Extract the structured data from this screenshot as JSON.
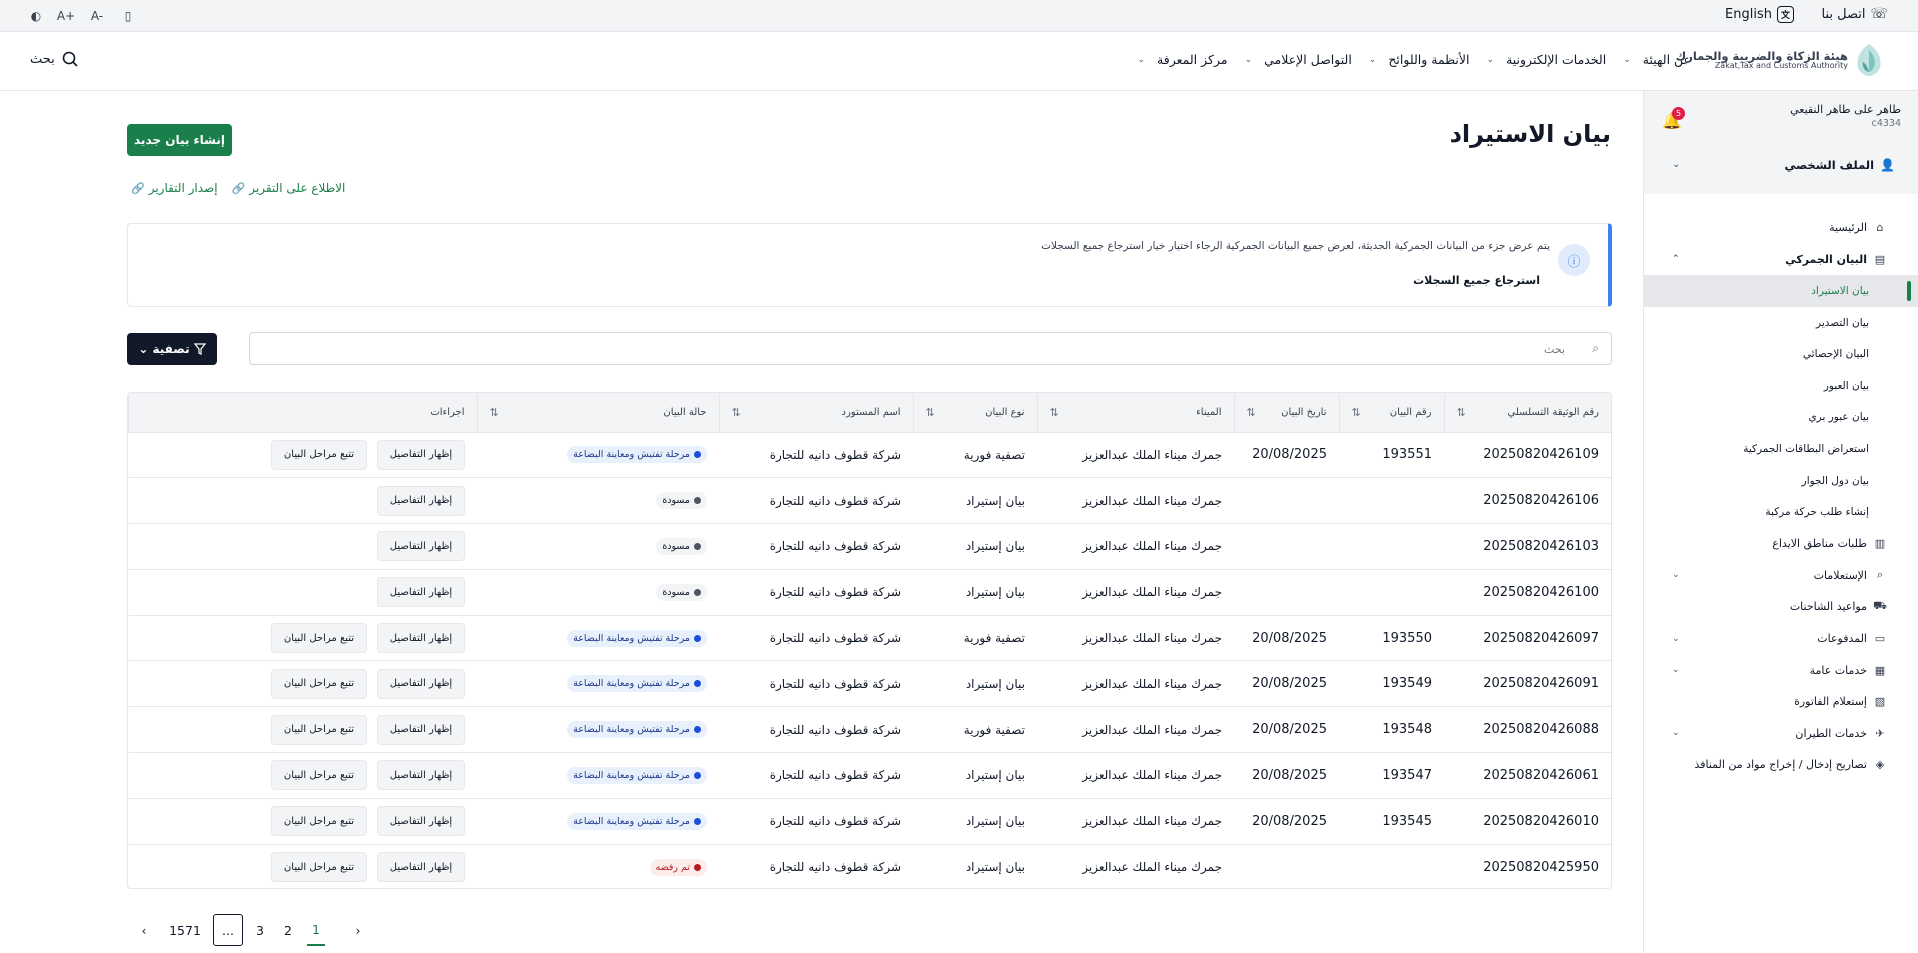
{
  "utility": {
    "contact_label": "اتصل بنا",
    "language_label": "English"
  },
  "nav": {
    "search_label": "بحث",
    "items": [
      {
        "label": "عن الهيئة"
      },
      {
        "label": "الخدمات الإلكترونية"
      },
      {
        "label": "الأنظمة واللوائح"
      },
      {
        "label": "التواصل الإعلامي"
      },
      {
        "label": "مركز المعرفة"
      }
    ],
    "logo_ar": "هيئة الزكاة والضريبة والجمارك",
    "logo_en": "Zakat,Tax and Customs Authority"
  },
  "page": {
    "title": "بيان الاستيراد",
    "create_button": "إنشاء بيان جديد",
    "link_report_view": "الاطلاع على التقرير",
    "link_reports_issue": "إصدار التقارير"
  },
  "info": {
    "message": "يتم عرض جزء من البيانات الجمركية الحديثة، لعرض جميع البيانات الجمركية الرجاء اختيار خيار استرجاع جميع السجلات",
    "action": "استرجاع جميع السجلات"
  },
  "filter": {
    "search_placeholder": "بحث",
    "filter_button": "تصفية"
  },
  "table": {
    "headers": [
      "رقم الوثيقة التسلسلي",
      "رقم البيان",
      "تاريخ البيان",
      "الميناء",
      "نوع البيان",
      "اسم المستورد",
      "حالة البيان",
      "اجراءات"
    ],
    "details_label": "إظهار التفاصيل",
    "track_label": "تتبع مراحل البيان",
    "rows": [
      {
        "serial": "20250820426109",
        "decl_no": "193551",
        "date": "20/08/2025",
        "port": "جمرك ميناء الملك عبدالعزيز",
        "type": "تصفية فورية",
        "importer": "شركة قطوف دانيه للتجارة",
        "status": "مرحلة تفتيش ومعاينة البضاعة",
        "status_kind": "inspect",
        "track": true
      },
      {
        "serial": "20250820426106",
        "decl_no": "",
        "date": "",
        "port": "جمرك ميناء الملك عبدالعزيز",
        "type": "بيان إستيراد",
        "importer": "شركة قطوف دانيه للتجارة",
        "status": "مسودة",
        "status_kind": "draft",
        "track": false
      },
      {
        "serial": "20250820426103",
        "decl_no": "",
        "date": "",
        "port": "جمرك ميناء الملك عبدالعزيز",
        "type": "بيان إستيراد",
        "importer": "شركة قطوف دانيه للتجارة",
        "status": "مسودة",
        "status_kind": "draft",
        "track": false
      },
      {
        "serial": "20250820426100",
        "decl_no": "",
        "date": "",
        "port": "جمرك ميناء الملك عبدالعزيز",
        "type": "بيان إستيراد",
        "importer": "شركة قطوف دانيه للتجارة",
        "status": "مسودة",
        "status_kind": "draft",
        "track": false
      },
      {
        "serial": "20250820426097",
        "decl_no": "193550",
        "date": "20/08/2025",
        "port": "جمرك ميناء الملك عبدالعزيز",
        "type": "تصفية فورية",
        "importer": "شركة قطوف دانيه للتجارة",
        "status": "مرحلة تفتيش ومعاينة البضاعة",
        "status_kind": "inspect",
        "track": true
      },
      {
        "serial": "20250820426091",
        "decl_no": "193549",
        "date": "20/08/2025",
        "port": "جمرك ميناء الملك عبدالعزيز",
        "type": "بيان إستيراد",
        "importer": "شركة قطوف دانيه للتجارة",
        "status": "مرحلة تفتيش ومعاينة البضاعة",
        "status_kind": "inspect",
        "track": true
      },
      {
        "serial": "20250820426088",
        "decl_no": "193548",
        "date": "20/08/2025",
        "port": "جمرك ميناء الملك عبدالعزيز",
        "type": "تصفية فورية",
        "importer": "شركة قطوف دانيه للتجارة",
        "status": "مرحلة تفتيش ومعاينة البضاعة",
        "status_kind": "inspect",
        "track": true
      },
      {
        "serial": "20250820426061",
        "decl_no": "193547",
        "date": "20/08/2025",
        "port": "جمرك ميناء الملك عبدالعزيز",
        "type": "بيان إستيراد",
        "importer": "شركة قطوف دانيه للتجارة",
        "status": "مرحلة تفتيش ومعاينة البضاعة",
        "status_kind": "inspect",
        "track": true
      },
      {
        "serial": "20250820426010",
        "decl_no": "193545",
        "date": "20/08/2025",
        "port": "جمرك ميناء الملك عبدالعزيز",
        "type": "بيان إستيراد",
        "importer": "شركة قطوف دانيه للتجارة",
        "status": "مرحلة تفتيش ومعاينة البضاعة",
        "status_kind": "inspect",
        "track": true
      },
      {
        "serial": "20250820425950",
        "decl_no": "",
        "date": "",
        "port": "جمرك ميناء الملك عبدالعزيز",
        "type": "بيان إستيراد",
        "importer": "شركة قطوف دانيه للتجارة",
        "status": "تم رفضه",
        "status_kind": "rejected",
        "track": true
      }
    ]
  },
  "pagination": {
    "pages": [
      "1",
      "2",
      "3"
    ],
    "current": "1",
    "ellipsis": "...",
    "last": "1571"
  },
  "sidebar": {
    "user_name": "طاهر على طاهر النقيعي",
    "user_id": "c4334",
    "notification_count": "5",
    "profile_label": "الملف الشخصي",
    "items": [
      {
        "label": "الرئيسية",
        "icon": "home-icon"
      },
      {
        "label": "البيان الجمركي",
        "icon": "document-icon",
        "expanded": true
      },
      {
        "label": "بيان الاستيراد",
        "sub": true,
        "active": true
      },
      {
        "label": "بيان التصدير",
        "sub": true
      },
      {
        "label": "البيان الإحصائي",
        "sub": true
      },
      {
        "label": "بيان العبور",
        "sub": true
      },
      {
        "label": "بيان عبور بري",
        "sub": true
      },
      {
        "label": "استعراض البطاقات الجمركية",
        "sub": true
      },
      {
        "label": "بيان دول الجوار",
        "sub": true
      },
      {
        "label": "إنشاء طلب حركة مركبة",
        "sub": true
      },
      {
        "label": "طلبات مناطق الايداع",
        "icon": "clipboard-icon"
      },
      {
        "label": "الإستعلامات",
        "icon": "search-doc-icon",
        "chevron": true
      },
      {
        "label": "مواعيد الشاحنات",
        "icon": "truck-icon"
      },
      {
        "label": "المدفوعات",
        "icon": "payment-icon",
        "chevron": true
      },
      {
        "label": "خدمات عامة",
        "icon": "services-icon",
        "chevron": true
      },
      {
        "label": "إستعلام الفاتورة",
        "icon": "invoice-icon"
      },
      {
        "label": "خدمات الطيران",
        "icon": "plane-icon",
        "chevron": true
      },
      {
        "label": "تصاريح إدخال / إخراج مواد من المنافذ",
        "icon": "permit-icon"
      }
    ]
  },
  "colors": {
    "brand_green": "#1b7f4b",
    "info_blue": "#3b82f6",
    "inspect_dot": "#1d4ed8",
    "rejected_red": "#b91c1c"
  }
}
